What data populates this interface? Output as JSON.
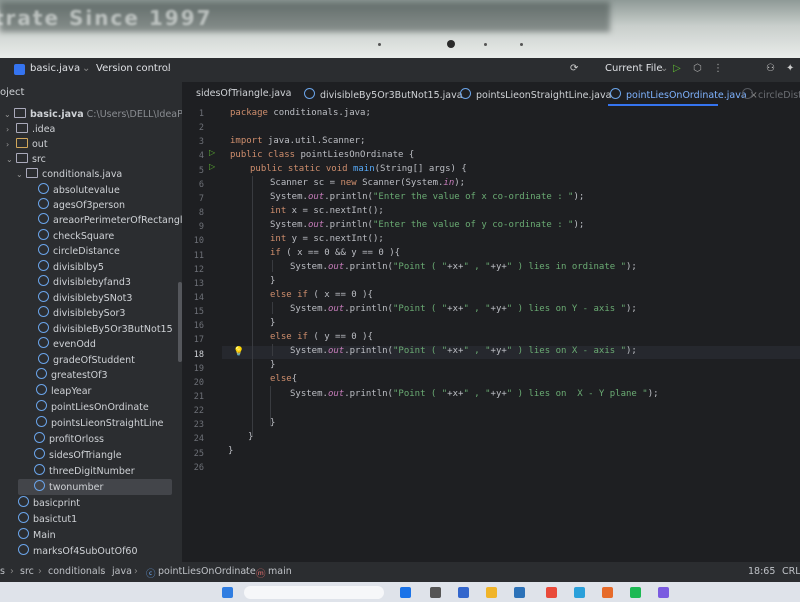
{
  "bezel": {
    "text": "trate Since 1997"
  },
  "toolbar": {
    "project_name": "basic.java",
    "version_control": "Version control",
    "run_config": "Current File"
  },
  "sidebar": {
    "header": "oject",
    "root": {
      "name": "basic.java",
      "path": "C:\\Users\\DELL\\IdeaProjects\\ba"
    },
    "folders": [
      ".idea",
      "out",
      "src",
      "conditionals.java"
    ],
    "files": [
      "absolutevalue",
      "agesOf3person",
      "areaorPerimeterOfRectangle",
      "checkSquare",
      "circleDistance",
      "divisiblby5",
      "divisiblebyfand3",
      "divisiblebySNot3",
      "divisiblebySor3",
      "divisibleBy5Or3ButNot15",
      "evenOdd",
      "gradeOfStuddent",
      "greatestOf3",
      "leapYear",
      "pointLiesOnOrdinate",
      "pointsLieonStraightLine",
      "profitOrloss",
      "sidesOfTriangle",
      "threeDigitNumber",
      "twonumber"
    ],
    "other_files": [
      "basicprint",
      "basictut1",
      "Main",
      "marksOf4SubOutOf60"
    ]
  },
  "tabs": [
    "sidesOfTriangle.java",
    "divisibleBy5Or3ButNot15.java",
    "pointsLieonStraightLine.java",
    "pointLiesOnOrdinate.java",
    "circleDista"
  ],
  "editor": {
    "current_line": 18,
    "line_numbers": [
      "1",
      "2",
      "3",
      "4",
      "5",
      "6",
      "7",
      "8",
      "9",
      "10",
      "11",
      "12",
      "13",
      "14",
      "15",
      "16",
      "17",
      "18",
      "19",
      "20",
      "21",
      "22",
      "23",
      "24",
      "25",
      "26"
    ],
    "code": {
      "l1": {
        "kw": "package",
        "rest": " conditionals.java;"
      },
      "l3": {
        "kw": "import",
        "rest": " java.util.Scanner;"
      },
      "l4": {
        "kw1": "public",
        "kw2": " class",
        "rest": " pointLiesOnOrdinate {"
      },
      "l5": {
        "kw1": "public",
        "kw2": " static",
        "kw3": " void",
        "fn": " main",
        "rest": "(String[] args) {"
      },
      "l6": {
        "a": "Scanner sc = ",
        "kw": "new",
        "b": " Scanner(System.",
        "it": "in",
        "c": ");"
      },
      "l7": {
        "a": "System.",
        "it": "out",
        "b": ".println(",
        "str": "\"Enter the value of x co-ordinate : \"",
        "c": ");"
      },
      "l8": {
        "kw": "int",
        "rest": " x = sc.nextInt();"
      },
      "l9": {
        "a": "System.",
        "it": "out",
        "b": ".println(",
        "str": "\"Enter the value of y co-ordinate : \"",
        "c": ");"
      },
      "l10": {
        "kw": "int",
        "rest": " y = sc.nextInt();"
      },
      "l11": {
        "kw": "if",
        "rest": " ( x == 0 && y == 0 ){"
      },
      "l12": {
        "a": "System.",
        "it": "out",
        "b": ".println(",
        "s1": "\"Point ( \"",
        "m1": "+x+",
        "s2": "\" , \"",
        "m2": "+y+",
        "s3": "\" ) lies in ordinate \"",
        "c": ");"
      },
      "l13": "}",
      "l14": {
        "kw1": "else",
        "kw2": " if",
        "rest": " ( x == 0 ){"
      },
      "l15": {
        "a": "System.",
        "it": "out",
        "b": ".println(",
        "s1": "\"Point ( \"",
        "m1": "+x+",
        "s2": "\" , \"",
        "m2": "+y+",
        "s3": "\" ) lies on Y - axis \"",
        "c": ");"
      },
      "l16": "}",
      "l17": {
        "kw1": "else",
        "kw2": " if",
        "rest": " ( y == 0 ){"
      },
      "l18": {
        "a": "System.",
        "it": "out",
        "b": ".println(",
        "s1": "\"Point ( \"",
        "m1": "+x+",
        "s2": "\" , \"",
        "m2": "+y+",
        "s3": "\" ) lies on X - axis \"",
        "c": ");"
      },
      "l19": "}",
      "l20": {
        "kw": "else",
        "rest": "{"
      },
      "l21": {
        "a": "System.",
        "it": "out",
        "b": ".println(",
        "s1": "\"Point ( \"",
        "m1": "+x+",
        "s2": "\" , \"",
        "m2": "+y+",
        "s3": "\" ) lies on  X - Y plane \"",
        "c": ");"
      },
      "l23": "}",
      "l24": "}",
      "l25": "}"
    }
  },
  "statusbar": {
    "breadcrumb": [
      "s",
      "src",
      "conditionals",
      "java",
      "pointLiesOnOrdinate",
      "main"
    ],
    "position": "18:65",
    "line_sep": "CRLF"
  },
  "colors": {
    "accent": "#3574f0",
    "keyword": "#cf8e6d",
    "string": "#6aab73",
    "static_field": "#c77dbb",
    "method": "#56a8f5"
  }
}
